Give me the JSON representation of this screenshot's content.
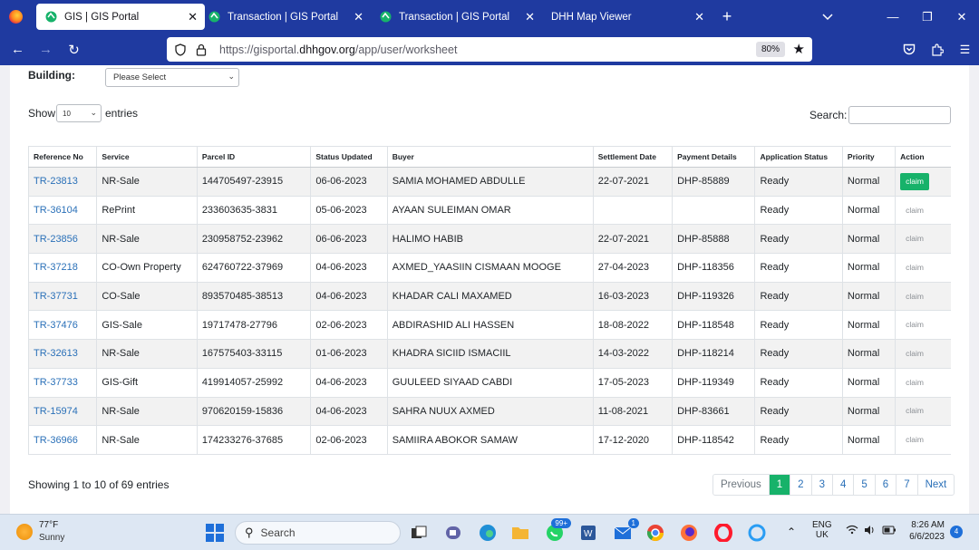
{
  "browser": {
    "tabs": [
      {
        "title": "GIS | GIS Portal",
        "active": true
      },
      {
        "title": "Transaction | GIS Portal",
        "active": false
      },
      {
        "title": "Transaction | GIS Portal",
        "active": false
      },
      {
        "title": "DHH Map Viewer",
        "active": false
      }
    ],
    "url_prefix": "https://gisportal.",
    "url_domain": "dhhgov.org",
    "url_path": "/app/user/worksheet",
    "zoom": "80%"
  },
  "filters": {
    "building_label": "Building:",
    "building_value": "Please Select",
    "show_label": "Show",
    "show_value": "10",
    "entries_label": "entries",
    "search_label": "Search:"
  },
  "table": {
    "headers": [
      "Reference No",
      "Service",
      "Parcel ID",
      "Status Updated",
      "Buyer",
      "Settlement Date",
      "Payment Details",
      "Application Status",
      "Priority",
      "Action"
    ],
    "rows": [
      {
        "ref": "TR-23813",
        "service": "NR-Sale",
        "parcel": "144705497-23915",
        "updated": "06-06-2023",
        "buyer": "SAMIA MOHAMED ABDULLE",
        "settlement": "22-07-2021",
        "payment": "DHP-85889",
        "status": "Ready",
        "priority": "Normal",
        "action": "claim",
        "action_enabled": true
      },
      {
        "ref": "TR-36104",
        "service": "RePrint",
        "parcel": "233603635-3831",
        "updated": "05-06-2023",
        "buyer": "AYAAN SULEIMAN OMAR",
        "settlement": "",
        "payment": "",
        "status": "Ready",
        "priority": "Normal",
        "action": "claim",
        "action_enabled": false
      },
      {
        "ref": "TR-23856",
        "service": "NR-Sale",
        "parcel": "230958752-23962",
        "updated": "06-06-2023",
        "buyer": "HALIMO HABIB",
        "settlement": "22-07-2021",
        "payment": "DHP-85888",
        "status": "Ready",
        "priority": "Normal",
        "action": "claim",
        "action_enabled": false
      },
      {
        "ref": "TR-37218",
        "service": "CO-Own Property",
        "parcel": "624760722-37969",
        "updated": "04-06-2023",
        "buyer": "AXMED_YAASIIN CISMAAN MOOGE",
        "settlement": "27-04-2023",
        "payment": "DHP-118356",
        "status": "Ready",
        "priority": "Normal",
        "action": "claim",
        "action_enabled": false
      },
      {
        "ref": "TR-37731",
        "service": "CO-Sale",
        "parcel": "893570485-38513",
        "updated": "04-06-2023",
        "buyer": "KHADAR CALI MAXAMED",
        "settlement": "16-03-2023",
        "payment": "DHP-119326",
        "status": "Ready",
        "priority": "Normal",
        "action": "claim",
        "action_enabled": false
      },
      {
        "ref": "TR-37476",
        "service": "GIS-Sale",
        "parcel": "19717478-27796",
        "updated": "02-06-2023",
        "buyer": "ABDIRASHID ALI HASSEN",
        "settlement": "18-08-2022",
        "payment": "DHP-118548",
        "status": "Ready",
        "priority": "Normal",
        "action": "claim",
        "action_enabled": false
      },
      {
        "ref": "TR-32613",
        "service": "NR-Sale",
        "parcel": "167575403-33115",
        "updated": "01-06-2023",
        "buyer": "KHADRA SICIID ISMACIIL",
        "settlement": "14-03-2022",
        "payment": "DHP-118214",
        "status": "Ready",
        "priority": "Normal",
        "action": "claim",
        "action_enabled": false
      },
      {
        "ref": "TR-37733",
        "service": "GIS-Gift",
        "parcel": "419914057-25992",
        "updated": "04-06-2023",
        "buyer": "GUULEED SIYAAD CABDI",
        "settlement": "17-05-2023",
        "payment": "DHP-119349",
        "status": "Ready",
        "priority": "Normal",
        "action": "claim",
        "action_enabled": false
      },
      {
        "ref": "TR-15974",
        "service": "NR-Sale",
        "parcel": "970620159-15836",
        "updated": "04-06-2023",
        "buyer": "SAHRA NUUX AXMED",
        "settlement": "11-08-2021",
        "payment": "DHP-83661",
        "status": "Ready",
        "priority": "Normal",
        "action": "claim",
        "action_enabled": false
      },
      {
        "ref": "TR-36966",
        "service": "NR-Sale",
        "parcel": "174233276-37685",
        "updated": "02-06-2023",
        "buyer": "SAMIIRA ABOKOR SAMAW",
        "settlement": "17-12-2020",
        "payment": "DHP-118542",
        "status": "Ready",
        "priority": "Normal",
        "action": "claim",
        "action_enabled": false
      }
    ]
  },
  "footer": {
    "info": "Showing 1 to 10 of 69 entries",
    "pagination": [
      "Previous",
      "1",
      "2",
      "3",
      "4",
      "5",
      "6",
      "7",
      "Next"
    ],
    "current_page": "1"
  },
  "taskbar": {
    "temperature": "77°F",
    "weather": "Sunny",
    "search_placeholder": "Search",
    "whatsapp_badge": "99+",
    "mail_badge": "1",
    "lang_top": "ENG",
    "lang_bottom": "UK",
    "time": "8:26 AM",
    "date": "6/6/2023",
    "notifications": "4"
  },
  "colors": {
    "browser_chrome": "#1f3aa0",
    "link": "#2a70b8",
    "claim_active": "#17b26a",
    "page_current": "#17b26a"
  }
}
